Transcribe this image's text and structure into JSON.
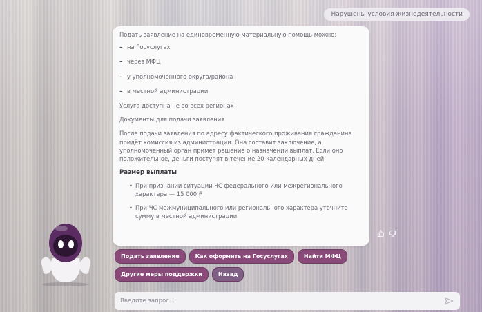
{
  "user_message": "Нарушены условия жизнедеятельности",
  "answer": {
    "intro": "Подать заявление на единовременную материальную помощь можно:",
    "channels": [
      "на Госуслугах",
      "через МФЦ",
      "у уполномоченного округа/района",
      "в местной администрации"
    ],
    "availability": "Услуга доступна не во всех регионах",
    "documents_link": "Документы для подачи заявления",
    "process": "После подачи заявления по адресу фактического проживания гражданина придёт комиссия из администрации. Она составит заключение, а уполномоченный орган примет решение о назначении выплат. Если оно положительное, деньги поступят в течение 20 календарных дней",
    "amounts_heading": "Размер выплаты",
    "amounts": [
      "При признании ситуации ЧС федерального или межрегионального характера — 15 000 ₽",
      "При ЧС межмуниципального или регионального характера уточните сумму в местной администрации"
    ]
  },
  "feedback": {
    "like_icon": "thumbs-up-icon",
    "dislike_icon": "thumbs-down-icon"
  },
  "quick_replies": [
    "Подать заявление",
    "Как оформить на Госуслугах",
    "Найти МФЦ",
    "Другие меры поддержки",
    "Назад"
  ],
  "input": {
    "placeholder": "Введите запрос...",
    "send_icon": "send-icon"
  },
  "colors": {
    "chip": "#8a4a79",
    "mascot": "#5a2c62",
    "card": "#fbfafb"
  }
}
